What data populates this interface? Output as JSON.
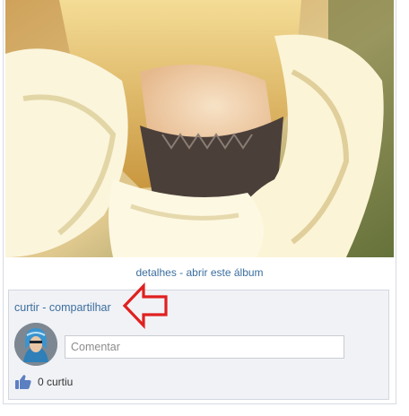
{
  "photo": {
    "links": {
      "details": "detalhes",
      "separator": " - ",
      "open_album": "abrir este álbum"
    }
  },
  "actions": {
    "like": "curtir",
    "separator": " - ",
    "share": "compartilhar"
  },
  "comment": {
    "placeholder": "Comentar"
  },
  "likes": {
    "count_text": "0 curtiu"
  },
  "colors": {
    "link": "#3b6e9f",
    "panel_bg": "#f1f2f6",
    "arrow": "#e02020"
  },
  "icons": {
    "like": "thumbs-up-icon",
    "annotation": "red-arrow-left-icon"
  }
}
